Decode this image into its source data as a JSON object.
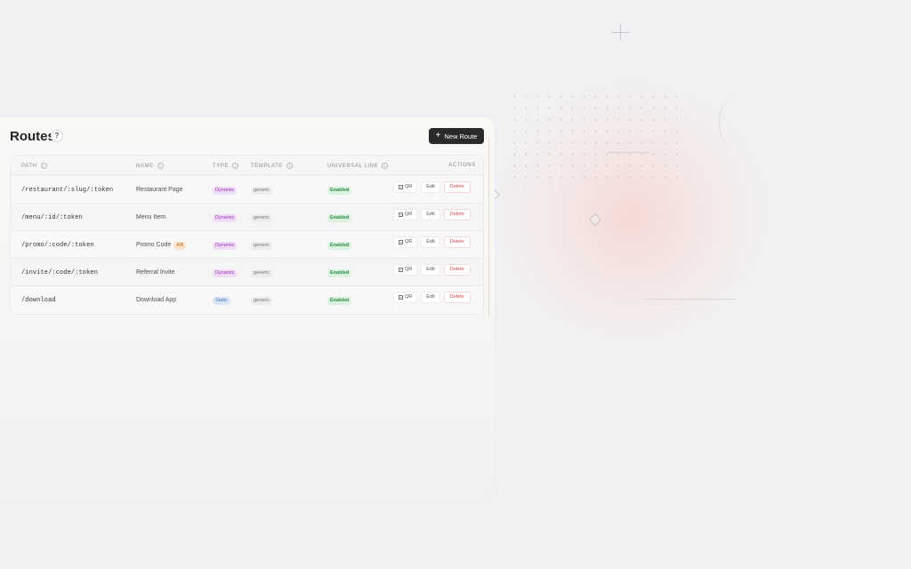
{
  "header": {
    "title": "Routes",
    "help_label": "?",
    "new_route_label": "New Route",
    "new_route_icon": "plus-icon"
  },
  "table": {
    "columns": [
      "PATH",
      "NAME",
      "TYPE",
      "TEMPLATE",
      "UNIVERSAL LINK",
      "ACTIONS"
    ],
    "rows": [
      {
        "path": "/restaurant/:slug/:token",
        "name": "Restaurant Page",
        "type": "Dynamic",
        "template": "generic",
        "link": "Enabled",
        "qr": "QR",
        "edit": "Edit",
        "delete": "Delete"
      },
      {
        "path": "/menu/:id/:token",
        "name": "Menu Item",
        "type": "Dynamic",
        "template": "generic",
        "link": "Enabled",
        "qr": "QR",
        "edit": "Edit",
        "delete": "Delete"
      },
      {
        "path": "/promo/:code/:token",
        "name": "Promo Code",
        "tag": "A/B",
        "type": "Dynamic",
        "template": "generic",
        "link": "Enabled",
        "qr": "QR",
        "edit": "Edit",
        "delete": "Delete"
      },
      {
        "path": "/invite/:code/:token",
        "name": "Referral Invite",
        "type": "Dynamic",
        "template": "generic",
        "link": "Enabled",
        "qr": "QR",
        "edit": "Edit",
        "delete": "Delete"
      },
      {
        "path": "/download",
        "name": "Download App",
        "type": "Static",
        "template": "generic",
        "link": "Enabled",
        "qr": "QR",
        "edit": "Edit",
        "delete": "Delete"
      }
    ]
  },
  "colors": {
    "primary_button": "#2a2a2c",
    "dynamic_badge": "#9a32b8",
    "static_badge": "#4b76b8",
    "enabled_badge": "#2e8b47",
    "delete_text": "#d24a4a"
  }
}
